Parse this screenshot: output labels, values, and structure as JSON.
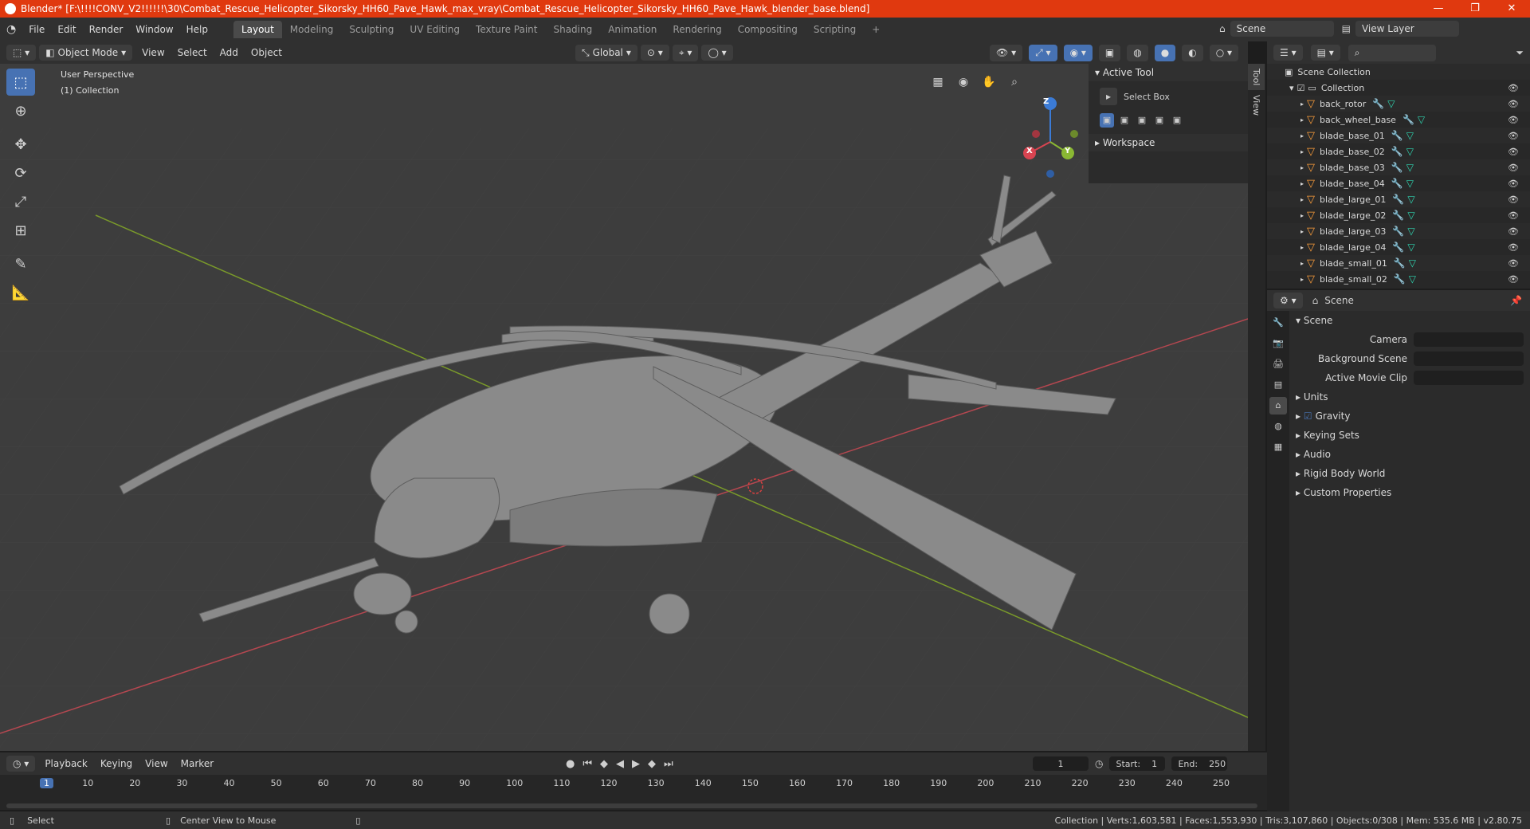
{
  "window": {
    "title": "Blender* [F:\\!!!!CONV_V2!!!!!!\\30\\Combat_Rescue_Helicopter_Sikorsky_HH60_Pave_Hawk_max_vray\\Combat_Rescue_Helicopter_Sikorsky_HH60_Pave_Hawk_blender_base.blend]",
    "minimize": "—",
    "maximize": "❐",
    "close": "✕"
  },
  "menu": [
    "File",
    "Edit",
    "Render",
    "Window",
    "Help"
  ],
  "workspaces": [
    "Layout",
    "Modeling",
    "Sculpting",
    "UV Editing",
    "Texture Paint",
    "Shading",
    "Animation",
    "Rendering",
    "Compositing",
    "Scripting"
  ],
  "workspace_add": "+",
  "scene_selector": {
    "scene": "Scene",
    "view_layer": "View Layer"
  },
  "viewport_header": {
    "mode": "Object Mode",
    "menus": [
      "View",
      "Select",
      "Add",
      "Object"
    ],
    "transform": "Global"
  },
  "viewport": {
    "perspective": "User Perspective",
    "collection": "(1) Collection"
  },
  "gizmo": {
    "x": "X",
    "y": "Y",
    "z": "Z"
  },
  "npanel": {
    "active_tool": "Active Tool",
    "select_box": "Select Box",
    "workspace": "Workspace",
    "tabs": [
      "Tool",
      "View"
    ]
  },
  "outliner": {
    "scene_collection": "Scene Collection",
    "collection": "Collection",
    "items": [
      "back_rotor",
      "back_wheel_base",
      "blade_base_01",
      "blade_base_02",
      "blade_base_03",
      "blade_base_04",
      "blade_large_01",
      "blade_large_02",
      "blade_large_03",
      "blade_large_04",
      "blade_small_01",
      "blade_small_02"
    ]
  },
  "properties": {
    "header": "Scene",
    "section": "Scene",
    "fields": [
      "Camera",
      "Background Scene",
      "Active Movie Clip"
    ],
    "sections": [
      "Units",
      "Gravity",
      "Keying Sets",
      "Audio",
      "Rigid Body World",
      "Custom Properties"
    ]
  },
  "timeline": {
    "menus": [
      "Playback",
      "Keying",
      "View",
      "Marker"
    ],
    "current_frame": "1",
    "start_label": "Start:",
    "start": "1",
    "end_label": "End:",
    "end": "250",
    "ticks": [
      "1",
      "10",
      "20",
      "30",
      "40",
      "50",
      "60",
      "70",
      "80",
      "90",
      "100",
      "110",
      "120",
      "130",
      "140",
      "150",
      "160",
      "170",
      "180",
      "190",
      "200",
      "210",
      "220",
      "230",
      "240",
      "250"
    ]
  },
  "status": {
    "left": "Select",
    "middle": "Center View to Mouse",
    "right": "Collection | Verts:1,603,581 | Faces:1,553,930 | Tris:3,107,860 | Objects:0/308 | Mem: 535.6 MB | v2.80.75"
  },
  "colors": {
    "accent": "#4772b3",
    "titlebar": "#e0390f",
    "object_icon": "#ff9f3b",
    "modifier_icon": "#4a90e2",
    "mesh_icon": "#2fd7b2"
  }
}
